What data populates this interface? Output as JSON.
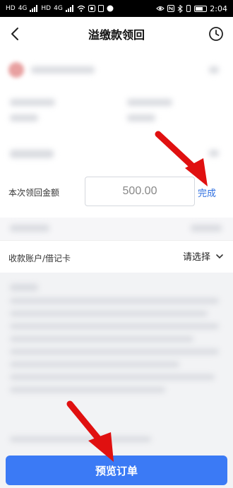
{
  "status_bar": {
    "left_icons": [
      "HD",
      "4G",
      "signal-icon",
      "HD",
      "4G",
      "signal-icon",
      "wifi-icon",
      "app-icon",
      "app-icon",
      "app-icon"
    ],
    "right_icons": [
      "eye-icon",
      "nfc-icon",
      "bluetooth-icon",
      "vibrate-icon"
    ],
    "battery_level": 0.7,
    "time": "2:04"
  },
  "navbar": {
    "title": "溢缴款领回",
    "back_icon": "back-arrow-icon",
    "history_icon": "clock-icon"
  },
  "amount": {
    "label": "本次领回金额",
    "value": "500.00",
    "done_label": "完成"
  },
  "account": {
    "label": "收款账户/借记卡",
    "select_text": "请选择"
  },
  "footer": {
    "button_label": "预览订单"
  },
  "colors": {
    "accent": "#3b7af5",
    "link": "#2f6fe0",
    "annotation_arrow": "#e01010"
  }
}
